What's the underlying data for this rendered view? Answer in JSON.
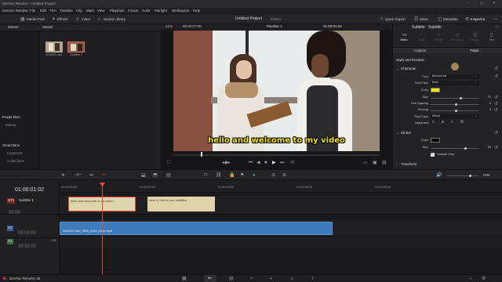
{
  "titlebar": {
    "app_title": "DaVinci Resolve - Untitled Project"
  },
  "menu": [
    "DaVinci Resolve",
    "File",
    "Edit",
    "Trim",
    "Timeline",
    "Clip",
    "Mark",
    "View",
    "Playback",
    "Fusion",
    "Color",
    "Fairlight",
    "Workspace",
    "Help"
  ],
  "toolbar": {
    "left_items": [
      "Media Pool",
      "Effects",
      "Index",
      "Sound Library"
    ],
    "project_name": "Untitled Project",
    "project_status": "Edited",
    "right_items": [
      "Quick Export",
      "Mixer",
      "Metadata",
      "Inspector"
    ]
  },
  "media_pool": {
    "header_left": "Master",
    "header_right": "Master",
    "clips": [
      {
        "name": "3294157-uhd...",
        "thumb_color": "#b9a48c"
      },
      {
        "name": "Timeline 1",
        "thumb_color": "#8b5a4a"
      }
    ],
    "power_bins_title": "Power Bins",
    "power_bins_item": "Master",
    "smart_bins_title": "Smart Bins",
    "smart_bins_items": [
      "Keywords",
      "Collections"
    ]
  },
  "viewer": {
    "zoom": "41%",
    "source_tc": "00:00:07:00",
    "timeline_name": "Timeline 1",
    "record_tc": "01:00:01:02",
    "subtitle_text": "hello and welcome to my video"
  },
  "inspector": {
    "title": "Subtitle - Subtitle",
    "icon_tabs": [
      "Video",
      "Audio",
      "Effects",
      "Transition",
      "Image",
      "File"
    ],
    "sub_tabs": [
      "Caption",
      "Track"
    ],
    "section_style": "Style and Position",
    "section_character": "Character",
    "props": [
      {
        "label": "Font",
        "value": "Montserrat"
      },
      {
        "label": "Font Face",
        "value": "Bold"
      },
      {
        "label": "Color",
        "value": ""
      },
      {
        "label": "Size",
        "value": "71"
      },
      {
        "label": "Line Spacing",
        "value": "0"
      },
      {
        "label": "Kerning",
        "value": "0"
      },
      {
        "label": "Font Case",
        "value": "Mixed"
      },
      {
        "label": "Alignment",
        "value": ""
      }
    ],
    "color_value": "#f5e400",
    "size_fraction": 0.62,
    "section_stroke": "Stroke",
    "stroke_color_label": "Color",
    "stroke_color": "#000000",
    "stroke_size_label": "Size",
    "stroke_size": "16",
    "outside_only": "Outside Only",
    "section_transform": "Transform"
  },
  "timeline": {
    "timecode": "01:00:01:02",
    "ruler": [
      "01:00:00:00",
      "01:00:02:00",
      "01:00:04:00",
      "01:00:06:00",
      "01:00:08:00"
    ],
    "tracks": {
      "st1_label": "ST1",
      "st1_name": "Subtitle 1",
      "v1_label": "V1",
      "a1_label": "A1",
      "a1_level": "2.0"
    },
    "subtitle_clips": [
      "hello and welcome to my video",
      "here is how to use subtitles"
    ],
    "video_clip": "3294157-uhd_3840_2160_25fps.mp4"
  },
  "footer": {
    "app_version": "DaVinci Resolve 19"
  }
}
